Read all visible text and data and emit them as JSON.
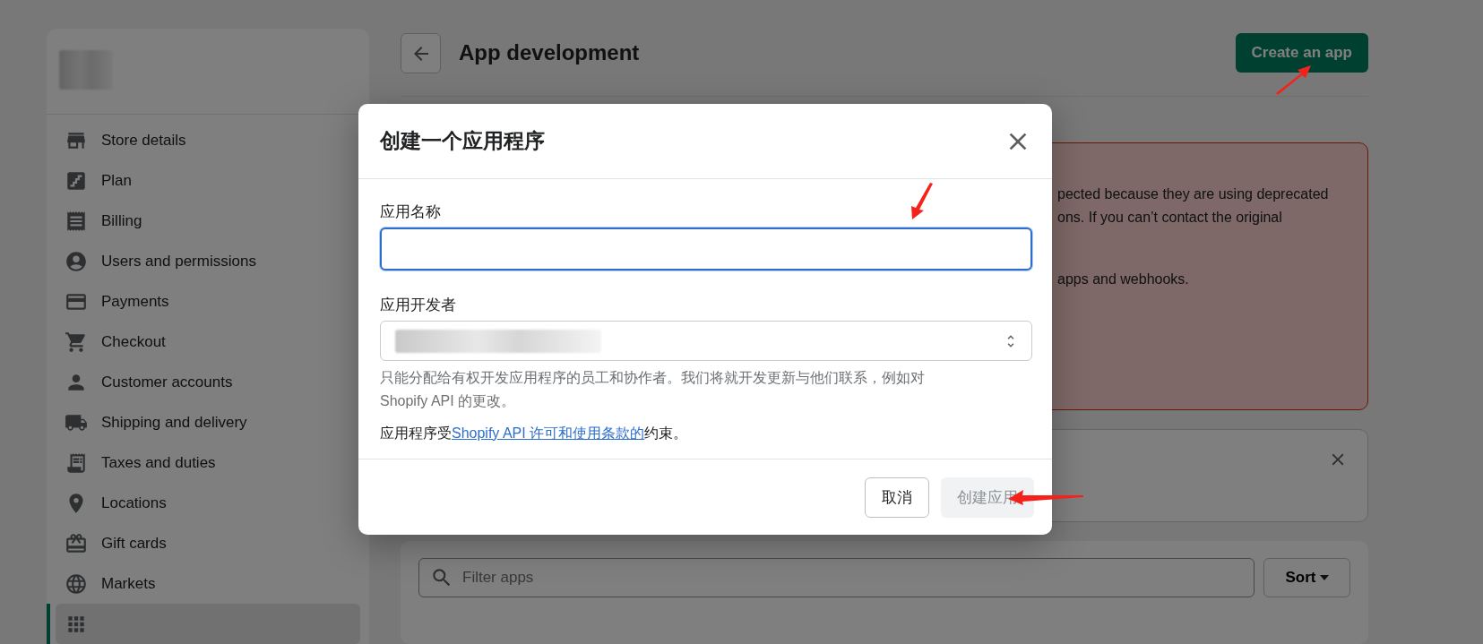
{
  "sidebar": {
    "items": [
      {
        "label": "Store details",
        "selected": false
      },
      {
        "label": "Plan",
        "selected": false
      },
      {
        "label": "Billing",
        "selected": false
      },
      {
        "label": "Users and permissions",
        "selected": false
      },
      {
        "label": "Payments",
        "selected": false
      },
      {
        "label": "Checkout",
        "selected": false
      },
      {
        "label": "Customer accounts",
        "selected": false
      },
      {
        "label": "Shipping and delivery",
        "selected": false
      },
      {
        "label": "Taxes and duties",
        "selected": false
      },
      {
        "label": "Locations",
        "selected": false
      },
      {
        "label": "Gift cards",
        "selected": false
      },
      {
        "label": "Markets",
        "selected": false
      },
      {
        "selected": true
      }
    ]
  },
  "header": {
    "title": "App development",
    "primary_button": "Create an app"
  },
  "banner": {
    "lines": [
      "pected because they are using deprecated",
      "ons. If you can’t contact the original",
      "apps and webhooks."
    ]
  },
  "filter": {
    "placeholder": "Filter apps",
    "sort_button": "Sort"
  },
  "dialog": {
    "title": "创建一个应用程序",
    "fields": [
      {
        "kind": "text",
        "label": "应用名称",
        "focused": true
      },
      {
        "kind": "select",
        "label": "应用开发者",
        "focused": false
      }
    ],
    "help_text": "只能分配给有权开发应用程序的员工和协作者。我们将就开发更新与他们联系，例如对 Shopify API 的更改。",
    "terms": {
      "before": "应用程序受",
      "link": "Shopify API 许可和使用条款的",
      "after": "约束。"
    },
    "buttons": [
      {
        "label": "取消",
        "disabled": false
      },
      {
        "label": "创建应用",
        "disabled": true
      }
    ]
  }
}
